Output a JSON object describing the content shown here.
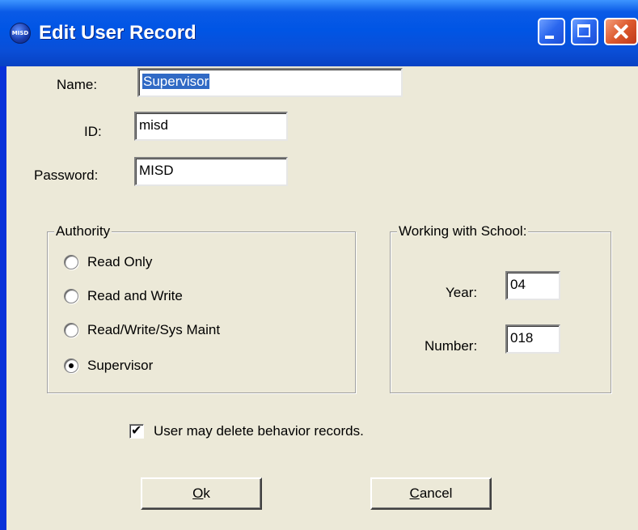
{
  "window": {
    "title": "Edit User Record",
    "app_icon_name": "misd-app-icon",
    "controls": [
      "minimize-icon",
      "maximize-icon",
      "close-icon"
    ]
  },
  "form": {
    "name": {
      "label": "Name:",
      "value": "Supervisor",
      "selected": true
    },
    "id": {
      "label": "ID:",
      "value": "misd"
    },
    "password": {
      "label": "Password:",
      "value": "MISD"
    }
  },
  "authority": {
    "title": "Authority",
    "options": [
      {
        "label": "Read Only",
        "checked": false
      },
      {
        "label": "Read and Write",
        "checked": false
      },
      {
        "label": "Read/Write/Sys Maint",
        "checked": false
      },
      {
        "label": "Supervisor",
        "checked": true
      }
    ]
  },
  "school": {
    "title": "Working with School:",
    "year": {
      "label": "Year:",
      "value": "04"
    },
    "number": {
      "label": "Number:",
      "value": "018"
    }
  },
  "delete_behavior": {
    "label": "User may delete behavior records.",
    "checked": true
  },
  "buttons": {
    "ok": {
      "mnemonic": "O",
      "rest": "k"
    },
    "cancel": {
      "mnemonic": "C",
      "rest": "ancel"
    }
  },
  "colors": {
    "titlebar": "#0055e5",
    "face": "#ece9d8",
    "selection": "#316ac5"
  }
}
